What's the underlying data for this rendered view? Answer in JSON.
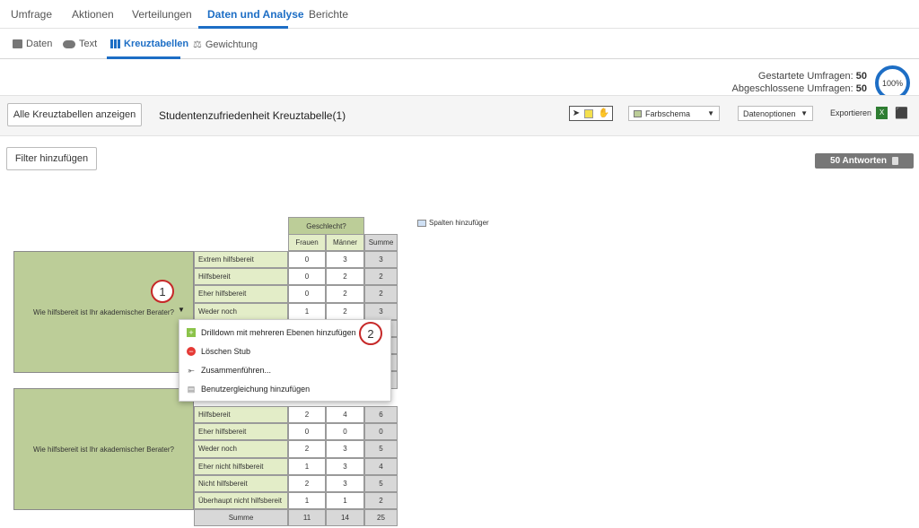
{
  "top_tabs": [
    "Umfrage",
    "Aktionen",
    "Verteilungen",
    "Daten und Analyse",
    "Berichte"
  ],
  "sub_tabs": [
    "Daten",
    "Text",
    "Kreuztabellen",
    "Gewichtung"
  ],
  "stats": {
    "started_label": "Gestartete Umfragen:",
    "started_value": "50",
    "completed_label": "Abgeschlossene Umfragen:",
    "completed_value": "50",
    "progress": "100%"
  },
  "toolbar": {
    "all_tables": "Alle Kreuztabellen anzeigen",
    "table_title": "Studentenzufriedenheit Kreuztabelle(1)",
    "color_scheme": "Farbschema",
    "data_options": "Datenoptionen",
    "export": "Exportieren"
  },
  "filter_button": "Filter hinzufügen",
  "answers": "50 Antworten",
  "add_columns": "Spalten hinzufüger",
  "table": {
    "banner": "Geschlecht?",
    "columns": [
      "Frauen",
      "Männer",
      "Summe"
    ],
    "question": "Wie hilfsbereit ist Ihr akademischer Berater?",
    "block1": [
      [
        "Extrem hilfsbereit",
        "0",
        "3",
        "3"
      ],
      [
        "Hilfsbereit",
        "0",
        "2",
        "2"
      ],
      [
        "Eher hilfsbereit",
        "0",
        "2",
        "2"
      ],
      [
        "Weder noch",
        "1",
        "2",
        "3"
      ]
    ],
    "block2": [
      [
        "Hilfsbereit",
        "2",
        "4",
        "6"
      ],
      [
        "Eher hilfsbereit",
        "0",
        "0",
        "0"
      ],
      [
        "Weder noch",
        "2",
        "3",
        "5"
      ],
      [
        "Eher nicht hilfsbereit",
        "1",
        "3",
        "4"
      ],
      [
        "Nicht hilfsbereit",
        "2",
        "3",
        "5"
      ],
      [
        "Überhaupt nicht hilfsbereit",
        "1",
        "1",
        "2"
      ]
    ],
    "total": [
      "Summe",
      "11",
      "14",
      "25"
    ]
  },
  "menu": {
    "items": [
      "Drilldown mit mehreren Ebenen hinzufügen",
      "Löschen Stub",
      "Zusammenführen...",
      "Benutzergleichung hinzufügen"
    ],
    "icons": [
      "plus-icon",
      "minus-circle-icon",
      "merge-icon",
      "calculator-icon"
    ]
  },
  "badges": [
    "1",
    "2"
  ],
  "colors": {
    "accent": "#1d6ec5",
    "header_green": "#bccd98",
    "row_green": "#e3edc8",
    "badge_red": "#c62828"
  }
}
